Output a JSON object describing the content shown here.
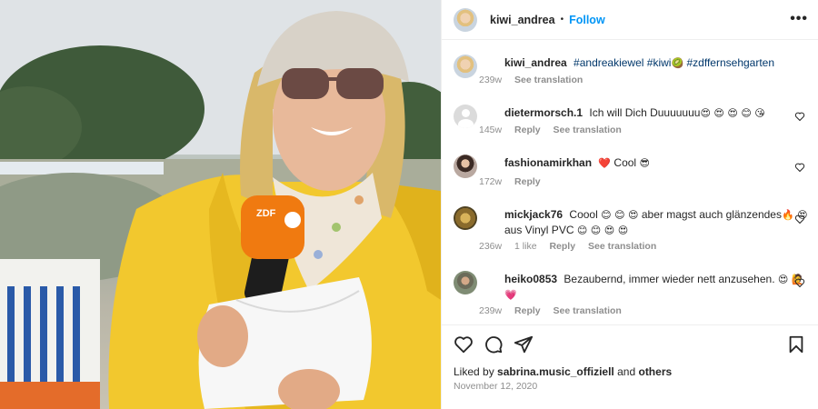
{
  "header": {
    "username": "kiwi_andrea",
    "separator": "•",
    "follow_label": "Follow",
    "more_label": "•••"
  },
  "caption": {
    "username": "kiwi_andrea",
    "tag1": "#andreakiewel",
    "tag2": "#kiwi",
    "emoji": "🥝",
    "tag3": "#zdffernsehgarten",
    "age": "239w",
    "translate": "See translation"
  },
  "comments": [
    {
      "username": "dietermorsch.1",
      "text": "Ich will Dich Duuuuuuu",
      "emojis": "😍 😍 😍 😊 😘",
      "age": "145w",
      "reply": "Reply",
      "translate": "See translation",
      "likes": ""
    },
    {
      "username": "fashionamirkhan",
      "text": "Cool",
      "emoji_before": "❤️",
      "emojis": "😎",
      "age": "172w",
      "reply": "Reply",
      "translate": "",
      "likes": ""
    },
    {
      "username": "mickjack76",
      "text": "Coool",
      "emojis": "😊 😊 😍",
      "text2": "aber magst auch glänzendes",
      "emojis2": "🔥 😍",
      "text3": "aus Vinyl PVC",
      "emojis3": "😊 😊 😍 😍",
      "age": "236w",
      "likes": "1 like",
      "reply": "Reply",
      "translate": "See translation"
    },
    {
      "username": "heiko0853",
      "text": "Bezaubernd, immer wieder nett anzusehen.",
      "emojis": "😍 🙋",
      "emojis2": "💗",
      "age": "239w",
      "reply": "Reply",
      "translate": "See translation"
    }
  ],
  "liked": {
    "prefix": "Liked by",
    "user": "sabrina.music_offiziell",
    "middle": "and",
    "others": "others"
  },
  "date": "November 12, 2020",
  "colors": {
    "follow": "#0095f6",
    "muted": "#8e8e8e",
    "raincoat": "#f2c82e"
  },
  "photo": {
    "mic_label": "ZDF"
  }
}
